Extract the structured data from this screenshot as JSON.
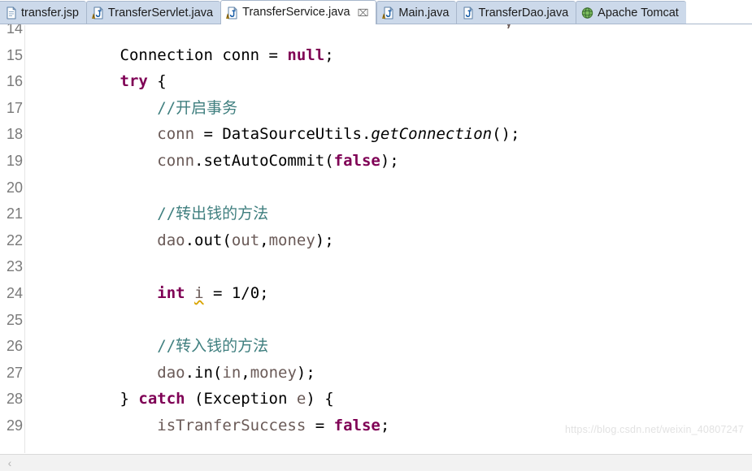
{
  "window": {
    "app": "eclipse-java-editor",
    "active_file": "TransferService.java"
  },
  "tab_bar": {
    "tabs": [
      {
        "label": "transfer.jsp",
        "icon": "jsp-file-icon",
        "active": false,
        "closable": false
      },
      {
        "label": "TransferServlet.java",
        "icon": "java-file-warning-icon",
        "active": false,
        "closable": false
      },
      {
        "label": "TransferService.java",
        "icon": "java-file-warning-icon",
        "active": true,
        "closable": true
      },
      {
        "label": "Main.java",
        "icon": "java-file-warning-icon",
        "active": false,
        "closable": false
      },
      {
        "label": "TransferDao.java",
        "icon": "java-file-icon",
        "active": false,
        "closable": false
      },
      {
        "label": "Apache Tomcat",
        "icon": "tomcat-globe-icon",
        "active": false,
        "closable": false
      }
    ],
    "close_glyph": "⌧"
  },
  "colors": {
    "keyword": "#7f0055",
    "comment": "#3f7f7f",
    "variable": "#6a5a57",
    "plain": "#000000",
    "linenumber": "#7a7a7a",
    "tab_inactive_bg": "#ccd9ea",
    "tab_active_bg": "#ffffff",
    "tab_border": "#a8b7cc",
    "warning_squiggle": "#d9a400",
    "editor_bg": "#ffffff"
  },
  "editor": {
    "first_visible_line": 14,
    "last_visible_line": 29,
    "clipped_glyph_above": "y",
    "lines": [
      {
        "n": "14",
        "tokens": []
      },
      {
        "n": "15",
        "tokens": [
          {
            "t": "        Connection conn = ",
            "c": "plain"
          },
          {
            "t": "null",
            "c": "kw"
          },
          {
            "t": ";",
            "c": "plain"
          }
        ]
      },
      {
        "n": "16",
        "tokens": [
          {
            "t": "        ",
            "c": "plain"
          },
          {
            "t": "try",
            "c": "kw"
          },
          {
            "t": " {",
            "c": "plain"
          }
        ]
      },
      {
        "n": "17",
        "tokens": [
          {
            "t": "            //开启事务",
            "c": "cmt"
          }
        ]
      },
      {
        "n": "18",
        "tokens": [
          {
            "t": "            ",
            "c": "plain"
          },
          {
            "t": "conn",
            "c": "var"
          },
          {
            "t": " = DataSourceUtils.",
            "c": "plain"
          },
          {
            "t": "getConnection",
            "c": "static"
          },
          {
            "t": "();",
            "c": "plain"
          }
        ]
      },
      {
        "n": "19",
        "tokens": [
          {
            "t": "            ",
            "c": "plain"
          },
          {
            "t": "conn",
            "c": "var"
          },
          {
            "t": ".setAutoCommit(",
            "c": "plain"
          },
          {
            "t": "false",
            "c": "kw"
          },
          {
            "t": ");",
            "c": "plain"
          }
        ]
      },
      {
        "n": "20",
        "tokens": []
      },
      {
        "n": "21",
        "tokens": [
          {
            "t": "            //转出钱的方法",
            "c": "cmt"
          }
        ]
      },
      {
        "n": "22",
        "tokens": [
          {
            "t": "            ",
            "c": "plain"
          },
          {
            "t": "dao",
            "c": "var"
          },
          {
            "t": ".out(",
            "c": "plain"
          },
          {
            "t": "out",
            "c": "var"
          },
          {
            "t": ",",
            "c": "plain"
          },
          {
            "t": "money",
            "c": "var"
          },
          {
            "t": ");",
            "c": "plain"
          }
        ]
      },
      {
        "n": "23",
        "tokens": []
      },
      {
        "n": "24",
        "tokens": [
          {
            "t": "            ",
            "c": "plain"
          },
          {
            "t": "int",
            "c": "kw"
          },
          {
            "t": " ",
            "c": "plain"
          },
          {
            "t": "i",
            "c": "warn"
          },
          {
            "t": " = 1/0;",
            "c": "plain"
          }
        ]
      },
      {
        "n": "25",
        "tokens": []
      },
      {
        "n": "26",
        "tokens": [
          {
            "t": "            //转入钱的方法",
            "c": "cmt"
          }
        ]
      },
      {
        "n": "27",
        "tokens": [
          {
            "t": "            ",
            "c": "plain"
          },
          {
            "t": "dao",
            "c": "var"
          },
          {
            "t": ".in(",
            "c": "plain"
          },
          {
            "t": "in",
            "c": "var"
          },
          {
            "t": ",",
            "c": "plain"
          },
          {
            "t": "money",
            "c": "var"
          },
          {
            "t": ");",
            "c": "plain"
          }
        ]
      },
      {
        "n": "28",
        "tokens": [
          {
            "t": "        } ",
            "c": "plain"
          },
          {
            "t": "catch",
            "c": "kw"
          },
          {
            "t": " (Exception ",
            "c": "plain"
          },
          {
            "t": "e",
            "c": "var"
          },
          {
            "t": ") {",
            "c": "plain"
          }
        ]
      },
      {
        "n": "29",
        "tokens": [
          {
            "t": "            ",
            "c": "plain"
          },
          {
            "t": "isTranferSuccess",
            "c": "var"
          },
          {
            "t": " = ",
            "c": "plain"
          },
          {
            "t": "false",
            "c": "kw"
          },
          {
            "t": ";",
            "c": "plain"
          }
        ]
      }
    ]
  },
  "watermark": {
    "text": "https://blog.csdn.net/weixin_40807247"
  },
  "scrollbar": {
    "left_arrow": "‹"
  }
}
